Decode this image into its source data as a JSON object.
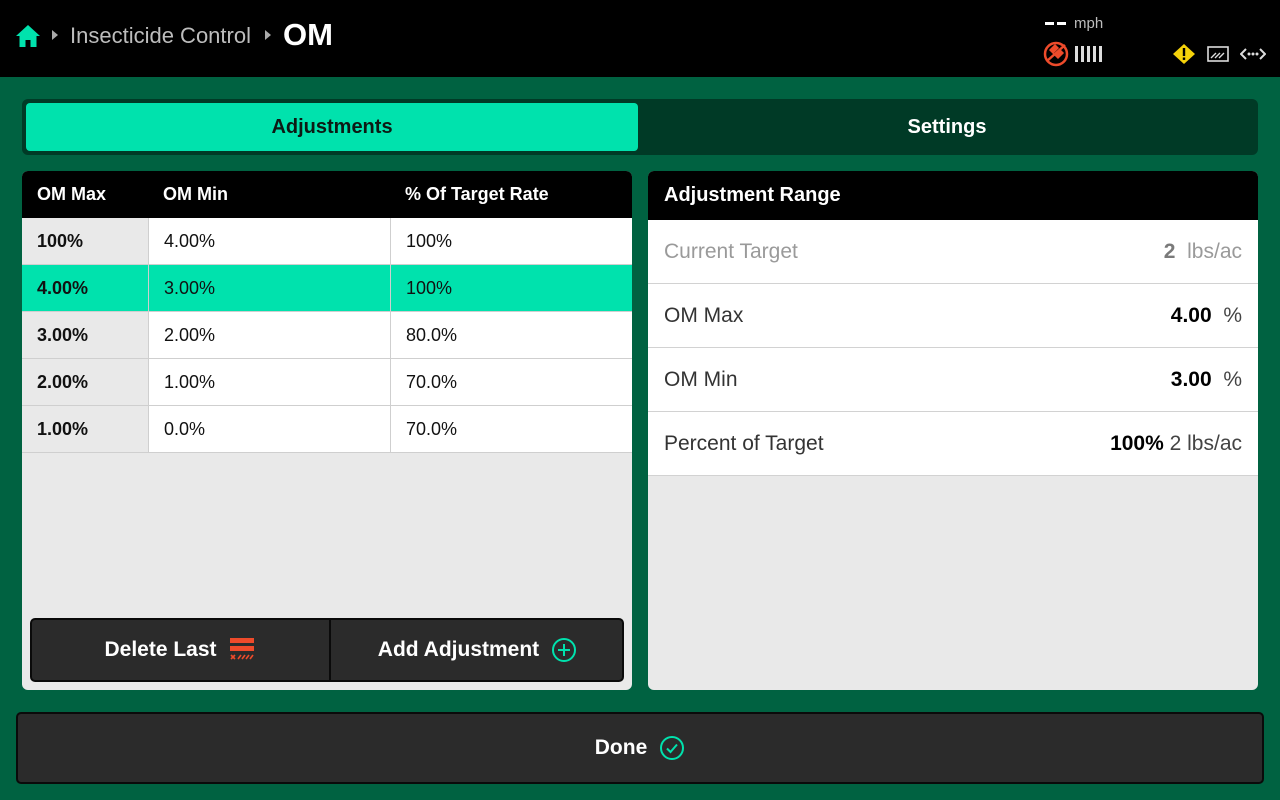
{
  "header": {
    "breadcrumb_parent": "Insecticide Control",
    "title": "OM",
    "speed_value": "--",
    "speed_unit": "mph"
  },
  "tabs": [
    {
      "label": "Adjustments",
      "active": true
    },
    {
      "label": "Settings",
      "active": false
    }
  ],
  "table": {
    "columns": [
      "OM Max",
      "OM Min",
      "% Of Target Rate"
    ],
    "rows": [
      [
        "100%",
        "4.00%",
        "100%"
      ],
      [
        "4.00%",
        "3.00%",
        "100%"
      ],
      [
        "3.00%",
        "2.00%",
        "80.0%"
      ],
      [
        "2.00%",
        "1.00%",
        "70.0%"
      ],
      [
        "1.00%",
        "0.0%",
        "70.0%"
      ]
    ],
    "selected_row": 1
  },
  "buttons": {
    "delete_last": "Delete Last",
    "add_adjustment": "Add Adjustment",
    "done": "Done"
  },
  "adjustment_range": {
    "title": "Adjustment Range",
    "rows": [
      {
        "label": "Current Target",
        "value": "2",
        "unit": "lbs/ac"
      },
      {
        "label": "OM Max",
        "value": "4.00",
        "unit": "%"
      },
      {
        "label": "OM Min",
        "value": "3.00",
        "unit": "%"
      },
      {
        "label": "Percent of Target",
        "value": "100%",
        "unit": "2 lbs/ac"
      }
    ]
  },
  "colors": {
    "accent": "#00e2ad",
    "background": "#006241",
    "warning": "#f5d20a",
    "alert": "#ee4b2b"
  }
}
